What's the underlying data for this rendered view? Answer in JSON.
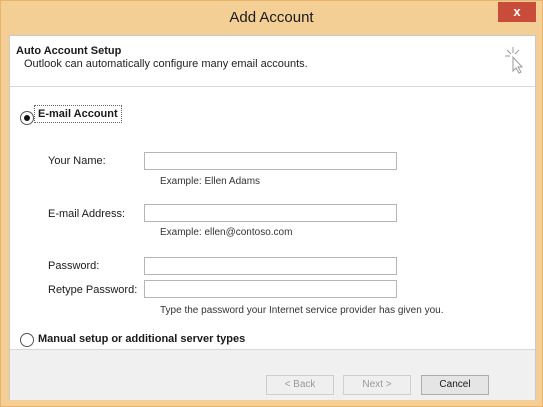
{
  "window": {
    "title": "Add Account",
    "close_label": "x"
  },
  "header": {
    "title": "Auto Account Setup",
    "subtitle": "Outlook can automatically configure many email accounts."
  },
  "options": {
    "email_account": {
      "label": "E-mail Account",
      "selected": true
    },
    "manual_setup": {
      "label": "Manual setup or additional server types",
      "selected": false
    }
  },
  "form": {
    "your_name": {
      "label": "Your Name:",
      "value": "",
      "hint": "Example: Ellen Adams"
    },
    "email_address": {
      "label": "E-mail Address:",
      "value": "",
      "hint": "Example: ellen@contoso.com"
    },
    "password": {
      "label": "Password:",
      "value": ""
    },
    "retype_password": {
      "label": "Retype Password:",
      "value": "",
      "hint": "Type the password your Internet service provider has given you."
    }
  },
  "buttons": {
    "back": "< Back",
    "next": "Next >",
    "cancel": "Cancel"
  }
}
